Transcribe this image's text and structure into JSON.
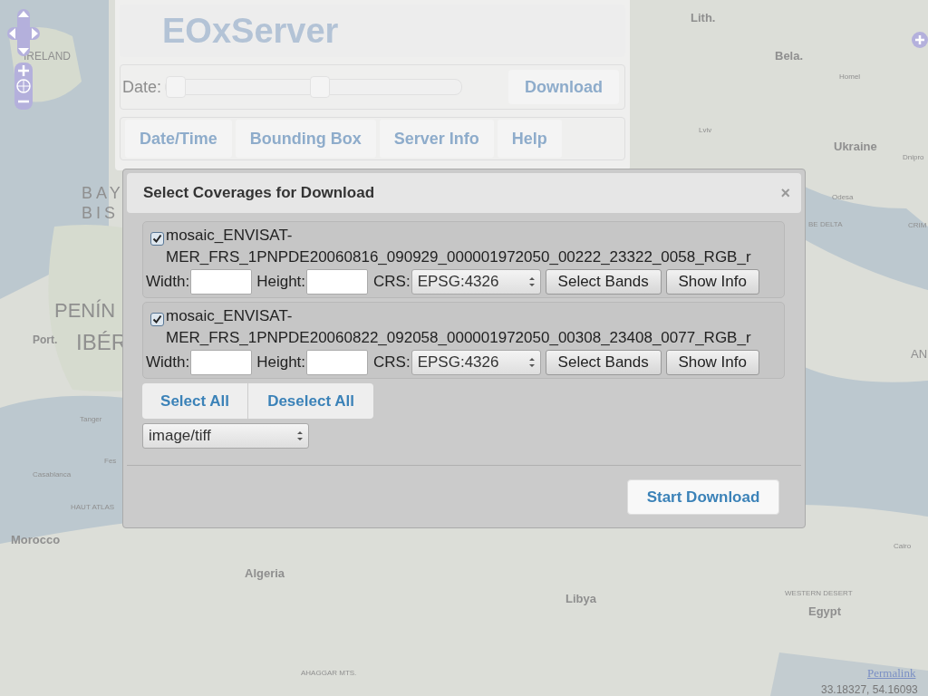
{
  "map": {
    "labels": [
      "Lith.",
      "Bela.",
      "Homel",
      "Lviv",
      "Ukraine",
      "Dnipro",
      "Odesa",
      "BE DELTA",
      "CRIM",
      "IRELAND",
      "BAY",
      "BIS",
      "PENÍN",
      "Port.",
      "IBÉR",
      "Tanger",
      "Casablanca",
      "Fes",
      "HAUT ATLAS",
      "Morocco",
      "Algeria",
      "Libya",
      "WESTERN DESERT",
      "Egypt",
      "Cairo",
      "AHAGGAR MTS.",
      "AN"
    ],
    "permalink": "Permalink",
    "coordinates": "33.18327, 54.16093"
  },
  "header": {
    "logo": "EOxServer",
    "date_label": "Date:",
    "date_slider": {
      "thumbs": [
        {
          "level": 0.0
        },
        {
          "level": 0.52
        }
      ]
    },
    "download_button": "Download",
    "tabs": [
      {
        "label": "Date/Time",
        "selected": false
      },
      {
        "label": "Bounding Box",
        "selected": false
      },
      {
        "label": "Server Info",
        "selected": false
      },
      {
        "label": "Help",
        "selected": false
      }
    ]
  },
  "dialog": {
    "title": "Select Coverages for Download",
    "close": "×",
    "coverages": [
      {
        "checked": true,
        "name": "mosaic_ENVISAT-MER_FRS_1PNPDE20060816_090929_000001972050_00222_23322_0058_RGB_r",
        "width_label": "Width:",
        "height_label": "Height:",
        "crs_label": "CRS:",
        "crs": "EPSG:4326",
        "select_bands": "Select Bands",
        "show_info": "Show Info"
      },
      {
        "checked": true,
        "name": "mosaic_ENVISAT-MER_FRS_1PNPDE20060822_092058_000001972050_00308_23408_0077_RGB_r",
        "width_label": "Width:",
        "height_label": "Height:",
        "crs_label": "CRS:",
        "crs": "EPSG:4326",
        "select_bands": "Select Bands",
        "show_info": "Show Info"
      }
    ],
    "select_all": "Select All",
    "deselect_all": "Deselect All",
    "format": "image/tiff",
    "start_download": "Start Download"
  }
}
